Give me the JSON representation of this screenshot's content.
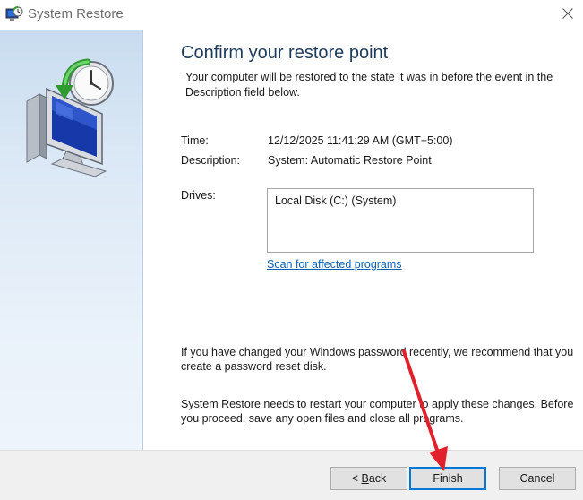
{
  "window": {
    "title": "System Restore",
    "close_glyph": "✕"
  },
  "icons": {
    "title_icon": "system-restore-icon",
    "hero_icon": "restore-computer-clock-icon",
    "close_icon": "close-icon"
  },
  "content": {
    "heading": "Confirm your restore point",
    "intro": "Your computer will be restored to the state it was in before the event in the Description field below.",
    "time_label": "Time:",
    "time_value": "12/12/2025 11:41:29 AM (GMT+5:00)",
    "description_label": "Description:",
    "description_value": "System: Automatic Restore Point",
    "drives_label": "Drives:",
    "drives": [
      "Local Disk (C:) (System)"
    ],
    "scan_link": "Scan for affected programs",
    "password_note": "If you have changed your Windows password recently, we recommend that you create a password reset disk.",
    "restart_note": "System Restore needs to restart your computer to apply these changes. Before you proceed, save any open files and close all programs."
  },
  "footer": {
    "back_prefix": "< ",
    "back_mnemonic": "B",
    "back_rest": "ack",
    "finish_label": "Finish",
    "cancel_label": "Cancel"
  },
  "colors": {
    "heading": "#1e3a5a",
    "link": "#0b5fb0",
    "annotation_arrow": "#e0212b",
    "default_button_border": "#0078d7"
  }
}
